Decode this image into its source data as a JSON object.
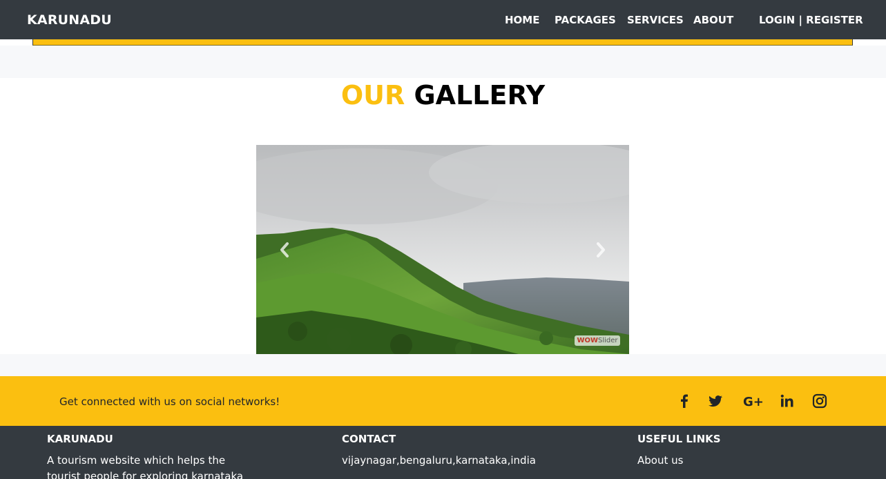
{
  "navbar": {
    "brand": "KARUNADU",
    "links": [
      "HOME",
      "PACKAGES",
      "SERVICES",
      "ABOUT"
    ],
    "auth": "LOGIN | REGISTER"
  },
  "gallery": {
    "title_accent": "OUR",
    "title_rest": "GALLERY",
    "slider_badge_a": "WOW",
    "slider_badge_b": "Slider"
  },
  "social": {
    "text": "Get connected with us on social networks!",
    "icons": [
      "facebook-icon",
      "twitter-icon",
      "google-plus-icon",
      "linkedin-icon",
      "instagram-icon"
    ]
  },
  "footer": {
    "col1_title": "KARUNADU",
    "col1_text": "A tourism website which helps the tourist people for exploring karnataka ..",
    "col2_title": "CONTACT",
    "col2_text": "vijaynagar,bengaluru,karnataka,india",
    "col3_title": "USEFUL LINKS",
    "col3_link": "About us"
  },
  "colors": {
    "navbar": "#343a40",
    "accent": "#fbbf10",
    "band": "#f7f8fa"
  }
}
